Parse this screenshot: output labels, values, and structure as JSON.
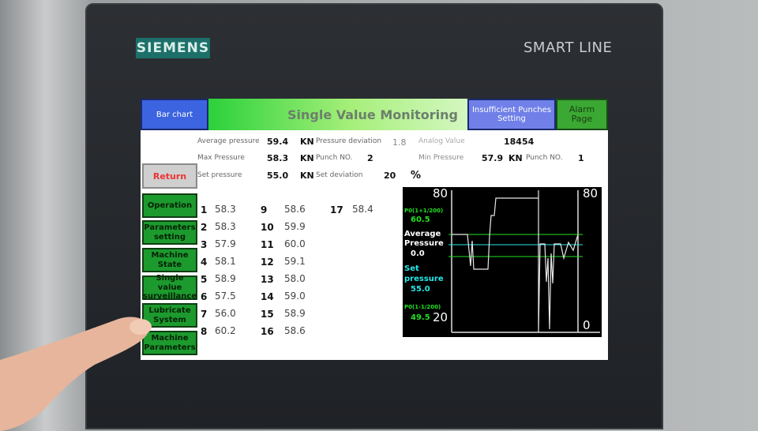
{
  "device": {
    "brand": "SIEMENS",
    "model": "SMART LINE"
  },
  "header": {
    "bar_chart": "Bar chart",
    "title": "Single Value Monitoring",
    "insufficient_line1": "Insufficient Punches",
    "insufficient_line2": "Setting",
    "alarm_line1": "Alarm",
    "alarm_line2": "Page"
  },
  "info": {
    "avg_label": "Average pressure",
    "avg_value": "59.4",
    "avg_unit": "KN",
    "dev_label": "Pressure deviation",
    "dev_value": "1.8",
    "analog_label": "Analog Value",
    "analog_value": "18454",
    "max_label": "Max Pressure",
    "max_value": "58.3",
    "max_unit": "KN",
    "punch_label": "Punch NO.",
    "punch_value": "2",
    "min_label": "Min Pressure",
    "min_value": "57.9",
    "min_unit": "KN",
    "punch2_label": "Punch NO.",
    "punch2_value": "1",
    "set_label": "Set pressure",
    "set_value": "55.0",
    "set_unit": "KN",
    "setdev_label": "Set deviation",
    "setdev_value": "20",
    "setdev_unit": "%"
  },
  "nav": {
    "return": "Return",
    "operation": "Operation",
    "params_l1": "Parameters",
    "params_l2": "setting",
    "machine_l1": "Machine",
    "machine_l2": "State",
    "single_l1": "Single value",
    "single_l2": "surveillance",
    "lub_l1": "Lubricate",
    "lub_l2": "System",
    "mparam_l1": "Machine",
    "mparam_l2": "Parameters"
  },
  "punches": [
    {
      "n": "1",
      "v": "58.3"
    },
    {
      "n": "2",
      "v": "58.3"
    },
    {
      "n": "3",
      "v": "57.9"
    },
    {
      "n": "4",
      "v": "58.1"
    },
    {
      "n": "5",
      "v": "58.9"
    },
    {
      "n": "6",
      "v": "57.5"
    },
    {
      "n": "7",
      "v": "56.0"
    },
    {
      "n": "8",
      "v": "60.2"
    },
    {
      "n": "9",
      "v": "58.6"
    },
    {
      "n": "10",
      "v": "59.9"
    },
    {
      "n": "11",
      "v": "60.0"
    },
    {
      "n": "12",
      "v": "59.1"
    },
    {
      "n": "13",
      "v": "58.0"
    },
    {
      "n": "14",
      "v": "59.0"
    },
    {
      "n": "15",
      "v": "58.9"
    },
    {
      "n": "16",
      "v": "58.6"
    },
    {
      "n": "17",
      "v": "58.4"
    }
  ],
  "trend": {
    "ymax_left": "80",
    "ymin_left": "20",
    "ymax_right": "80",
    "ymin_right": "0",
    "upper_label": "P0(1+1/200)",
    "upper_value": "60.5",
    "avg_label_l1": "Average",
    "avg_label_l2": "Pressure",
    "avg_value": "0.0",
    "set_label_l1": "Set",
    "set_label_l2": "pressure",
    "set_value": "55.0",
    "lower_label": "P0(1-1/200)",
    "lower_value": "49.5",
    "colors": {
      "limit": "#22e022",
      "set": "#27e6e6",
      "trace": "#e8e8e8"
    }
  }
}
